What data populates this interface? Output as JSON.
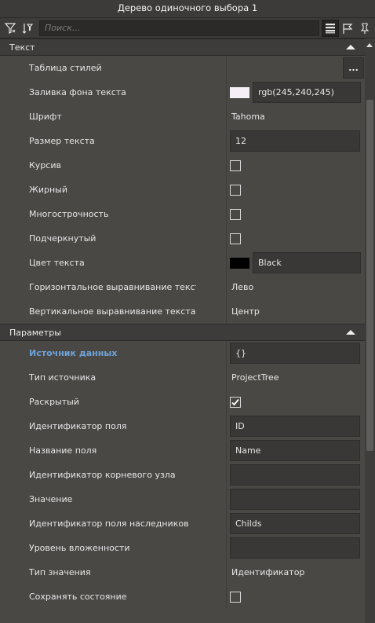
{
  "window": {
    "title": "Дерево одиночного выбора 1"
  },
  "toolbar": {
    "search_placeholder": "Поиск..."
  },
  "sections": {
    "text": {
      "title": "Текст",
      "style_table": "Таблица стилей",
      "style_table_button": "...",
      "bg_fill": "Заливка фона текста",
      "bg_fill_value": "rgb(245,240,245)",
      "font": "Шрифт",
      "font_value": "Tahoma",
      "text_size": "Размер текста",
      "text_size_value": "12",
      "italic": "Курсив",
      "bold": "Жирный",
      "multiline": "Многострочность",
      "underline": "Подчеркнутый",
      "text_color": "Цвет текста",
      "text_color_value": "Black",
      "h_align": "Горизонтальное выравнивание текста",
      "h_align_value": "Лево",
      "v_align": "Вертикальное выравнивание текста",
      "v_align_value": "Центр"
    },
    "params": {
      "title": "Параметры",
      "data_source": "Источник данных",
      "data_source_value": "{}",
      "source_type": "Тип источника",
      "source_type_value": "ProjectTree",
      "expanded": "Раскрытый",
      "field_id": "Идентификатор поля",
      "field_id_value": "ID",
      "field_name": "Название поля",
      "field_name_value": "Name",
      "root_id": "Идентификатор корневого узла",
      "root_id_value": "",
      "value": "Значение",
      "value_value": "",
      "children_id": "Идентификатор поля наследников",
      "children_id_value": "Childs",
      "nesting_level": "Уровень вложенности",
      "nesting_level_value": "",
      "value_type": "Тип значения",
      "value_type_value": "Идентификатор",
      "save_state": "Сохранять состояние"
    }
  },
  "state": {
    "italic": false,
    "bold": false,
    "multiline": false,
    "underline": false,
    "expanded": true,
    "save_state": false
  },
  "colors": {
    "bg_fill_swatch": "#f5f0f5",
    "text_color_swatch": "#000000",
    "highlight_label": "#6da3d7"
  },
  "icons": [
    "filter-icon",
    "filter-clear-icon",
    "list-view-icon",
    "flag-icon",
    "pin-icon"
  ]
}
